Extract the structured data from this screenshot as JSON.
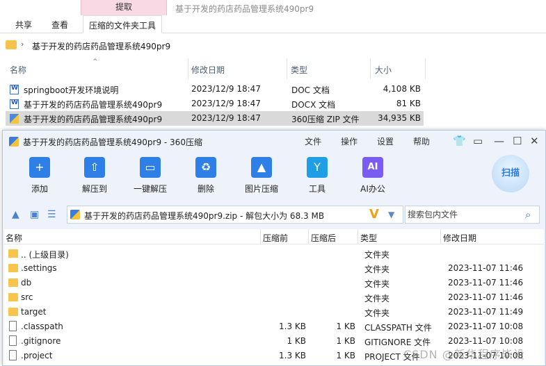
{
  "explorer": {
    "context_tab": "提取",
    "window_title": "基于开发的药店药品管理系统490pr9",
    "tabs": [
      "共享",
      "查看",
      "压缩的文件夹工具"
    ],
    "address": "基于开发的药店药品管理系统490pr9",
    "columns": [
      "名称",
      "修改日期",
      "类型",
      "大小"
    ],
    "files": [
      {
        "name": "springboot开发环境说明",
        "date": "2023/12/9 18:47",
        "type": "DOC 文档",
        "size": "4,108 KB",
        "icon": "word-doc-icon"
      },
      {
        "name": "基于开发的药店药品管理系统490pr9",
        "date": "2023/12/9 18:47",
        "type": "DOCX 文档",
        "size": "81 KB",
        "icon": "word-doc-icon"
      },
      {
        "name": "基于开发的药店药品管理系统490pr9",
        "date": "2023/12/9 18:47",
        "type": "360压缩 ZIP 文件",
        "size": "34,935 KB",
        "icon": "zip-archive-icon",
        "selected": true
      }
    ]
  },
  "zip": {
    "title": "基于开发的药店药品管理系统490pr9 - 360压缩",
    "menu": [
      "文件",
      "操作",
      "设置",
      "帮助"
    ],
    "tools": [
      {
        "label": "添加",
        "icon": "add-icon",
        "color": "#2f80e6",
        "glyph": "+"
      },
      {
        "label": "解压到",
        "icon": "extract-to-icon",
        "color": "#2f80e6",
        "glyph": "⇧"
      },
      {
        "label": "一键解压",
        "icon": "one-click-extract-icon",
        "color": "#2f80e6",
        "glyph": "▭"
      },
      {
        "label": "删除",
        "icon": "delete-icon",
        "color": "#2f80e6",
        "glyph": "♻"
      },
      {
        "label": "图片压缩",
        "icon": "image-compress-icon",
        "color": "#2f80e6",
        "glyph": "▲"
      },
      {
        "label": "工具",
        "icon": "tools-icon",
        "color": "#1f9ee6",
        "glyph": "Y"
      },
      {
        "label": "AI办公",
        "icon": "ai-office-icon",
        "color": "#7a5cf0",
        "glyph": "AI"
      }
    ],
    "scan_label": "扫描",
    "path": "基于开发的药店药品管理系统490pr9.zip - 解包大小为 68.3 MB",
    "search_placeholder": "搜索包内文件",
    "columns": [
      "名称",
      "压缩前",
      "压缩后",
      "类型",
      "修改日期"
    ],
    "rows": [
      {
        "name": ".. (上级目录)",
        "before": "",
        "after": "",
        "type": "文件夹",
        "date": "",
        "kind": "folder"
      },
      {
        "name": ".settings",
        "before": "",
        "after": "",
        "type": "文件夹",
        "date": "2023-11-07 11:46",
        "kind": "folder"
      },
      {
        "name": "db",
        "before": "",
        "after": "",
        "type": "文件夹",
        "date": "2023-11-07 11:46",
        "kind": "folder"
      },
      {
        "name": "src",
        "before": "",
        "after": "",
        "type": "文件夹",
        "date": "2023-11-07 11:46",
        "kind": "folder"
      },
      {
        "name": "target",
        "before": "",
        "after": "",
        "type": "文件夹",
        "date": "2023-11-07 11:49",
        "kind": "folder"
      },
      {
        "name": ".classpath",
        "before": "1.3 KB",
        "after": "1 KB",
        "type": "CLASSPATH 文件",
        "date": "2023-11-07 10:08",
        "kind": "file"
      },
      {
        "name": ".gitignore",
        "before": "1 KB",
        "after": "1 KB",
        "type": "GITIGNORE 文件",
        "date": "2023-11-07 10:08",
        "kind": "file"
      },
      {
        "name": ".project",
        "before": "1.3 KB",
        "after": "1 KB",
        "type": "PROJECT 文件",
        "date": "2023-11-07 10:08",
        "kind": "file"
      }
    ]
  },
  "watermark": "CSDN @新华程序毕设"
}
